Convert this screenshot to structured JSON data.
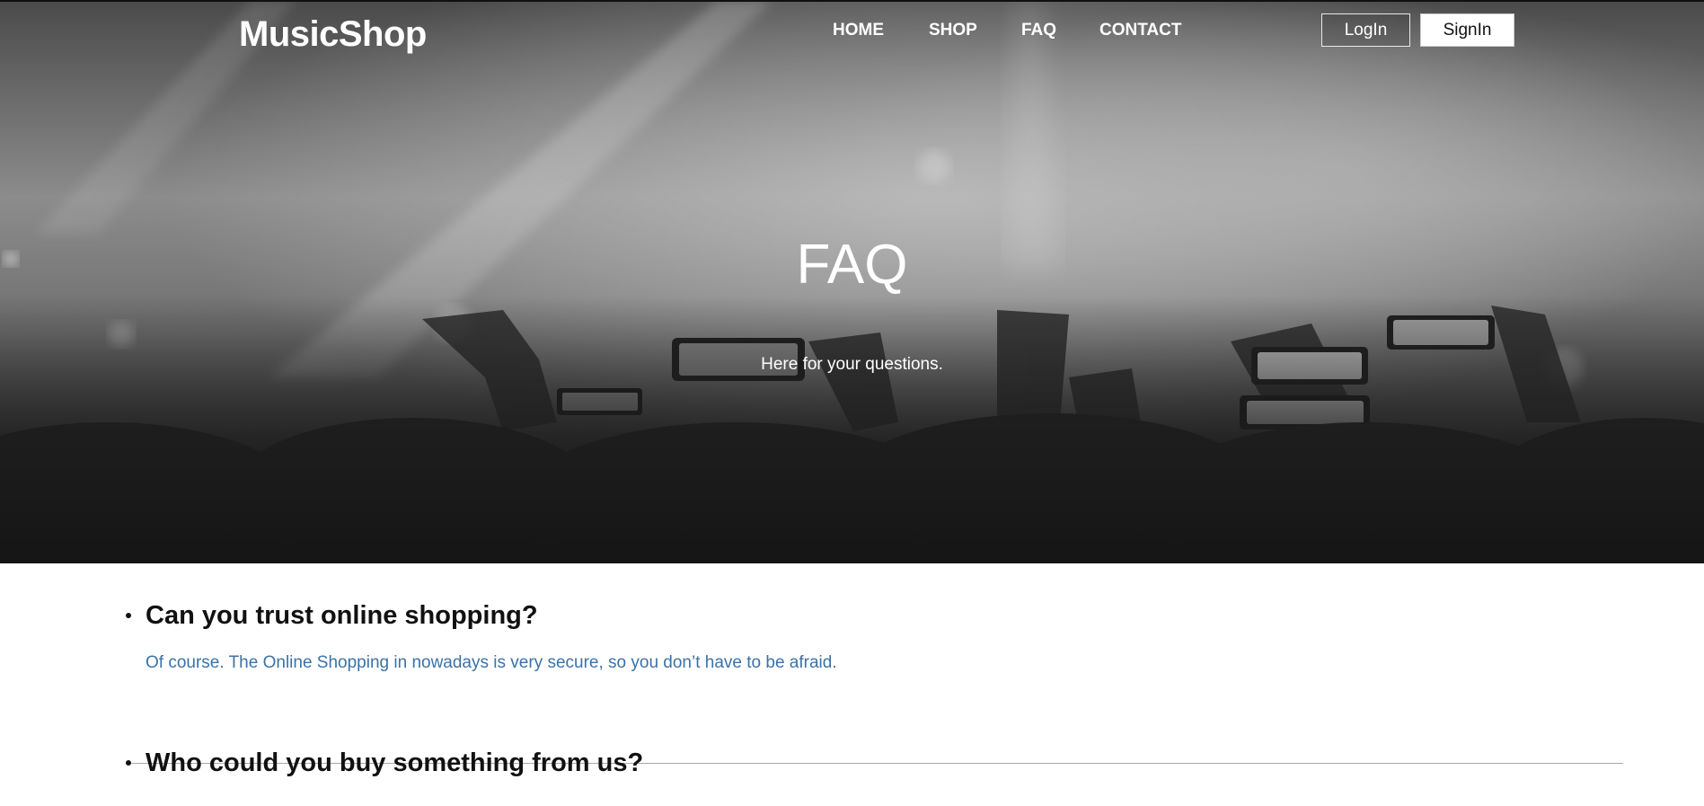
{
  "header": {
    "brand": "MusicShop",
    "nav": [
      {
        "label": "HOME"
      },
      {
        "label": "SHOP"
      },
      {
        "label": "FAQ"
      },
      {
        "label": "CONTACT"
      }
    ],
    "login_label": "LogIn",
    "signin_label": "SignIn"
  },
  "hero": {
    "title": "FAQ",
    "subtitle": "Here for your questions.",
    "background": "grayscale concert crowd photo"
  },
  "faq": {
    "items": [
      {
        "question": "Can you trust online shopping?",
        "answer": "Of course. The Online Shopping in nowadays is very secure, so you don’t have to be afraid."
      },
      {
        "question": "Who could you buy something from us?"
      }
    ]
  },
  "colors": {
    "answer_text": "#3a72a8",
    "question_text": "#111111",
    "divider": "#a8a8a8"
  }
}
